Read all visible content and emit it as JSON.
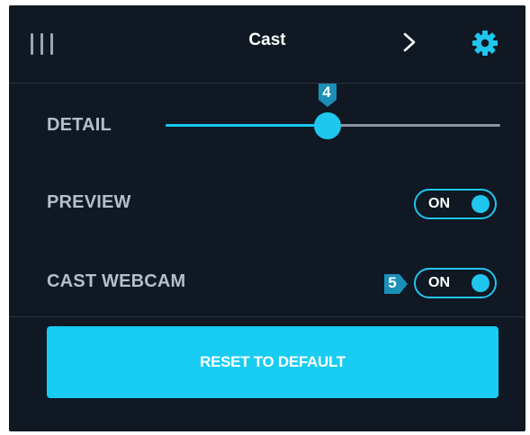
{
  "header": {
    "menu_icon": "menu-bars-icon",
    "title": "Cast",
    "next_icon": "chevron-right-icon",
    "settings_icon": "gear-icon"
  },
  "detail": {
    "label": "DETAIL",
    "slider_value_fraction": 0.485,
    "callout": "4"
  },
  "preview": {
    "label": "PREVIEW",
    "toggle_text": "ON"
  },
  "cast_webcam": {
    "label": "CAST WEBCAM",
    "toggle_text": "ON",
    "callout": "5"
  },
  "reset_button": {
    "label": "RESET TO DEFAULT"
  },
  "colors": {
    "background": "#0f1823",
    "accent": "#18ccf2",
    "label": "#b5bfca",
    "track": "#8a95a2"
  }
}
